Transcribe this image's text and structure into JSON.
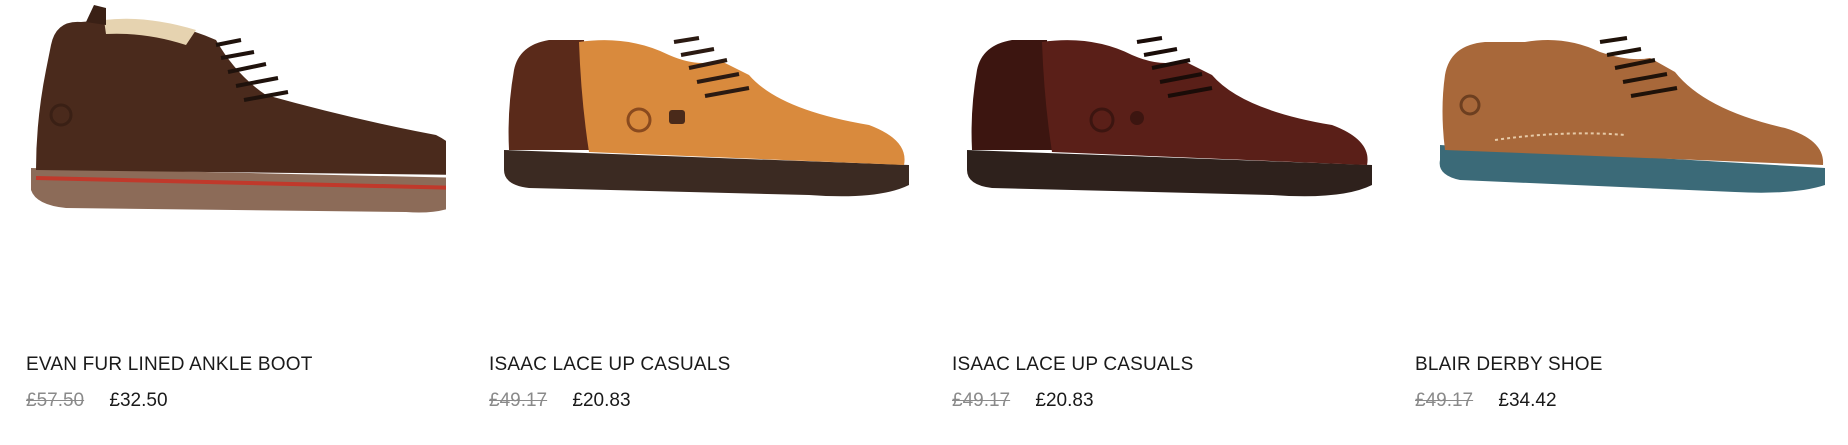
{
  "products": [
    {
      "name": "EVAN FUR LINED ANKLE BOOT",
      "old_price": "£57.50",
      "new_price": "£32.50",
      "colors": {
        "upper": "#4a2a1c",
        "sole": "#8c6b58",
        "accent": "#c0392b",
        "lining": "#e6d3b0"
      }
    },
    {
      "name": "ISAAC LACE UP CASUALS",
      "old_price": "£49.17",
      "new_price": "£20.83",
      "colors": {
        "upper": "#d98a3d",
        "heel": "#5a2a1a",
        "sole": "#3b2a22"
      }
    },
    {
      "name": "ISAAC LACE UP CASUALS",
      "old_price": "£49.17",
      "new_price": "£20.83",
      "colors": {
        "upper": "#5a1f18",
        "sole": "#2e211c"
      }
    },
    {
      "name": "BLAIR DERBY SHOE",
      "old_price": "£49.17",
      "new_price": "£34.42",
      "colors": {
        "upper": "#a8683a",
        "sole": "#3b6a78"
      }
    }
  ]
}
